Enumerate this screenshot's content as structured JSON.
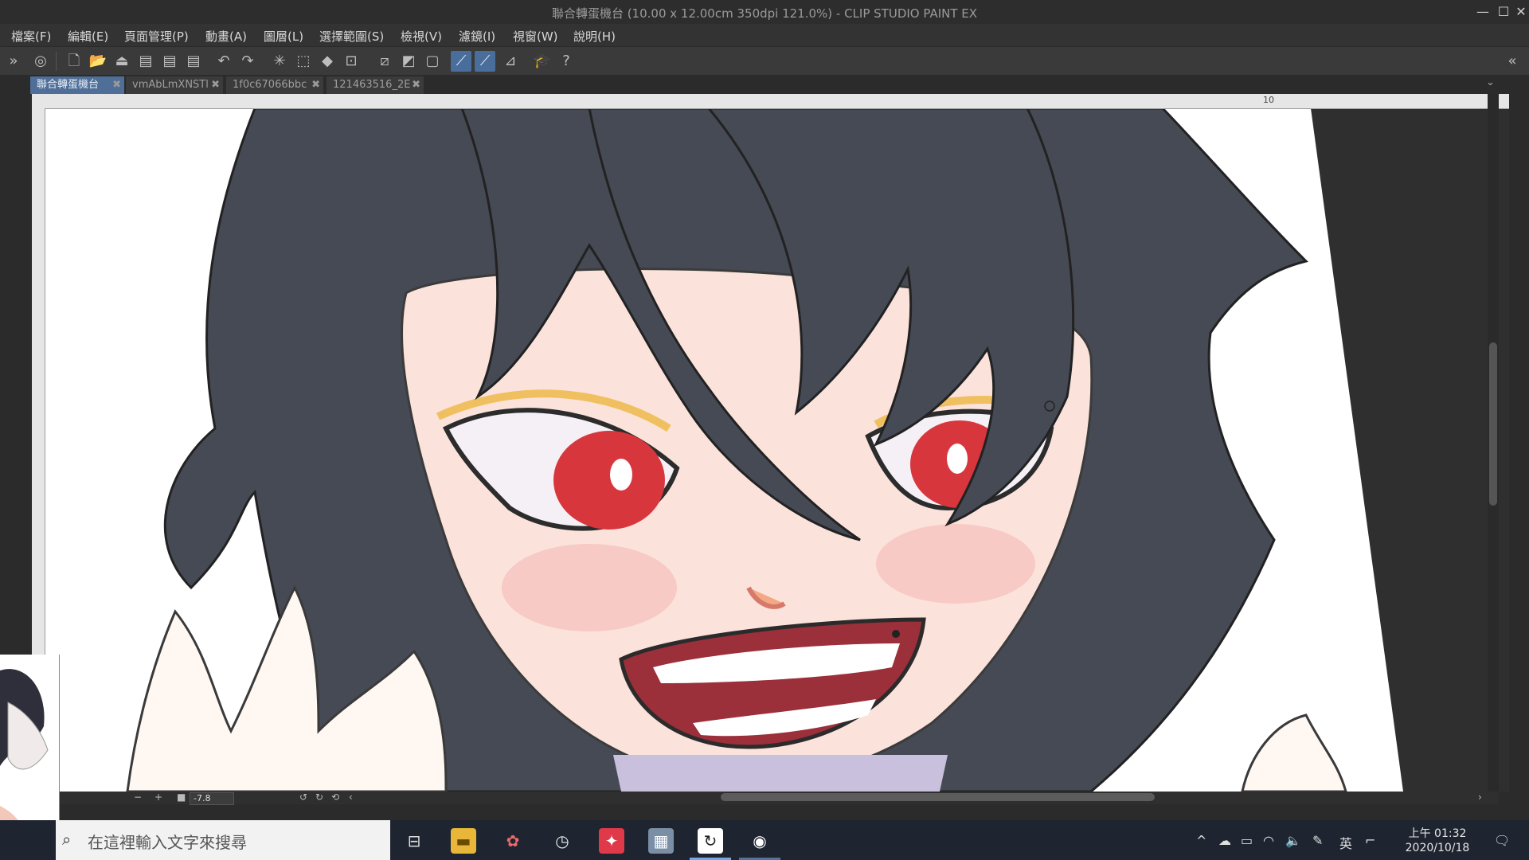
{
  "window": {
    "title": "聯合轉蛋機台 (10.00 x 12.00cm 350dpi 121.0%)  - CLIP STUDIO PAINT EX",
    "minimize_label": "—",
    "maximize_label": "☐",
    "close_label": "✕"
  },
  "menu": {
    "items": [
      {
        "label": "檔案(F)"
      },
      {
        "label": "編輯(E)"
      },
      {
        "label": "頁面管理(P)"
      },
      {
        "label": "動畫(A)"
      },
      {
        "label": "圖層(L)"
      },
      {
        "label": "選擇範圍(S)"
      },
      {
        "label": "檢視(V)"
      },
      {
        "label": "濾鏡(I)"
      },
      {
        "label": "視窗(W)"
      },
      {
        "label": "說明(H)"
      }
    ]
  },
  "tabs": [
    {
      "label": "聯合轉蛋機台",
      "close": "✖",
      "active": true
    },
    {
      "label": "vmAbLmXNSTl",
      "close": "✖",
      "active": false
    },
    {
      "label": "1f0c67066bbc",
      "close": "✖",
      "active": false
    },
    {
      "label": "121463516_2E",
      "close": "✖",
      "active": false
    }
  ],
  "ruler": {
    "top_label": "10"
  },
  "status": {
    "zoom_value": "-7.8",
    "minus": "−",
    "plus": "+"
  },
  "taskbar": {
    "search_placeholder": "在這裡輸入文字來搜尋",
    "ime_label": "英",
    "clock_time": "上午 01:32",
    "clock_date": "2020/10/18"
  },
  "colors": {
    "accent": "#4f6f98",
    "hair": "#464a55",
    "skin": "#fbe3dc",
    "eye": "#d8363d"
  }
}
